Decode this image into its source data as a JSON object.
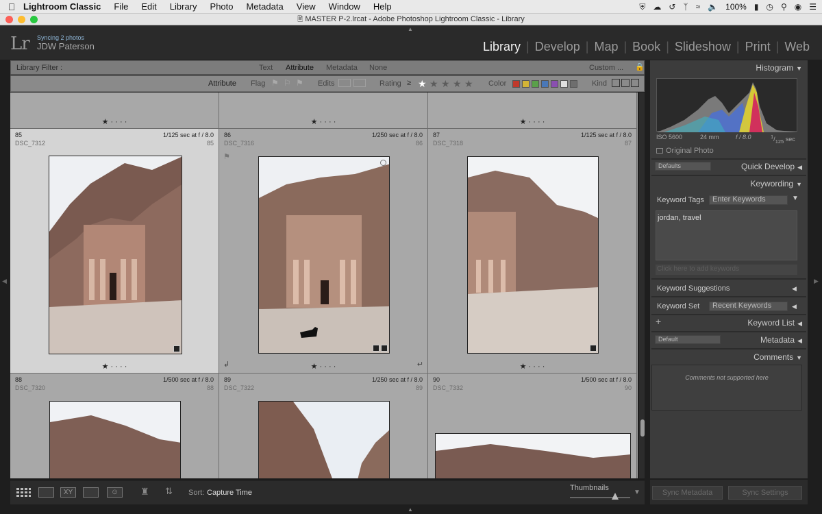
{
  "menubar": {
    "app_name": "Lightroom Classic",
    "items": [
      "File",
      "Edit",
      "Library",
      "Photo",
      "Metadata",
      "View",
      "Window",
      "Help"
    ],
    "battery": "100%"
  },
  "window": {
    "title": "MASTER P-2.lrcat - Adobe Photoshop Lightroom Classic - Library"
  },
  "identity": {
    "status": "Syncing 2 photos",
    "user": "JDW Paterson"
  },
  "modules": [
    "Library",
    "Develop",
    "Map",
    "Book",
    "Slideshow",
    "Print",
    "Web"
  ],
  "filter": {
    "label": "Library Filter :",
    "tabs": [
      "Text",
      "Attribute",
      "Metadata",
      "None"
    ],
    "active_tab": "Attribute",
    "preset": "Custom ...",
    "attribute_label": "Attribute",
    "flag_label": "Flag",
    "edits_label": "Edits",
    "rating_label": "Rating",
    "rating_op": "≥",
    "rating_value": 1,
    "color_label": "Color",
    "kind_label": "Kind",
    "colors": [
      "#c0392b",
      "#d4b437",
      "#5aa04a",
      "#4a78b8",
      "#8a4fb0",
      "#e0e0e0",
      "#6e6e6e"
    ]
  },
  "grid": {
    "top_row_rating": 1,
    "cells": [
      {
        "index": "85",
        "exif": "1/125 sec at f / 8.0",
        "filename": "DSC_7312",
        "num": "85",
        "rating": 1,
        "selected": true
      },
      {
        "index": "86",
        "exif": "1/250 sec at f / 8.0",
        "filename": "DSC_7316",
        "num": "86",
        "rating": 1,
        "selected": false
      },
      {
        "index": "87",
        "exif": "1/125 sec at f / 8.0",
        "filename": "DSC_7318",
        "num": "87",
        "rating": 1,
        "selected": false
      },
      {
        "index": "88",
        "exif": "1/500 sec at f / 8.0",
        "filename": "DSC_7320",
        "num": "88",
        "rating": 0,
        "selected": false
      },
      {
        "index": "89",
        "exif": "1/250 sec at f / 8.0",
        "filename": "DSC_7322",
        "num": "89",
        "rating": 0,
        "selected": false
      },
      {
        "index": "90",
        "exif": "1/500 sec at f / 8.0",
        "filename": "DSC_7332",
        "num": "90",
        "rating": 0,
        "selected": false
      }
    ]
  },
  "right_panel": {
    "histogram": {
      "title": "Histogram",
      "iso": "ISO 5600",
      "focal": "24 mm",
      "aperture": "f / 8.0",
      "shutter_num": "1",
      "shutter_den": "125",
      "shutter_unit": "sec",
      "original_photo": "Original Photo"
    },
    "quick_develop": {
      "title": "Quick Develop",
      "preset": "Defaults"
    },
    "keywording": {
      "title": "Keywording",
      "tags_label": "Keyword Tags",
      "tags_mode": "Enter Keywords",
      "keywords": "jordan, travel",
      "add_placeholder": "Click here to add keywords",
      "suggestions_label": "Keyword Suggestions",
      "set_label": "Keyword Set",
      "set_value": "Recent Keywords"
    },
    "keyword_list": {
      "title": "Keyword List",
      "plus": "+"
    },
    "metadata": {
      "title": "Metadata",
      "preset": "Default"
    },
    "comments": {
      "title": "Comments",
      "note": "Comments not supported here"
    }
  },
  "toolbar": {
    "sort_label": "Sort:",
    "sort_value": "Capture Time",
    "thumbnails_label": "Thumbnails",
    "thumbnail_size_fraction": 0.75
  },
  "bottom": {
    "sync_metadata": "Sync Metadata",
    "sync_settings": "Sync Settings"
  }
}
